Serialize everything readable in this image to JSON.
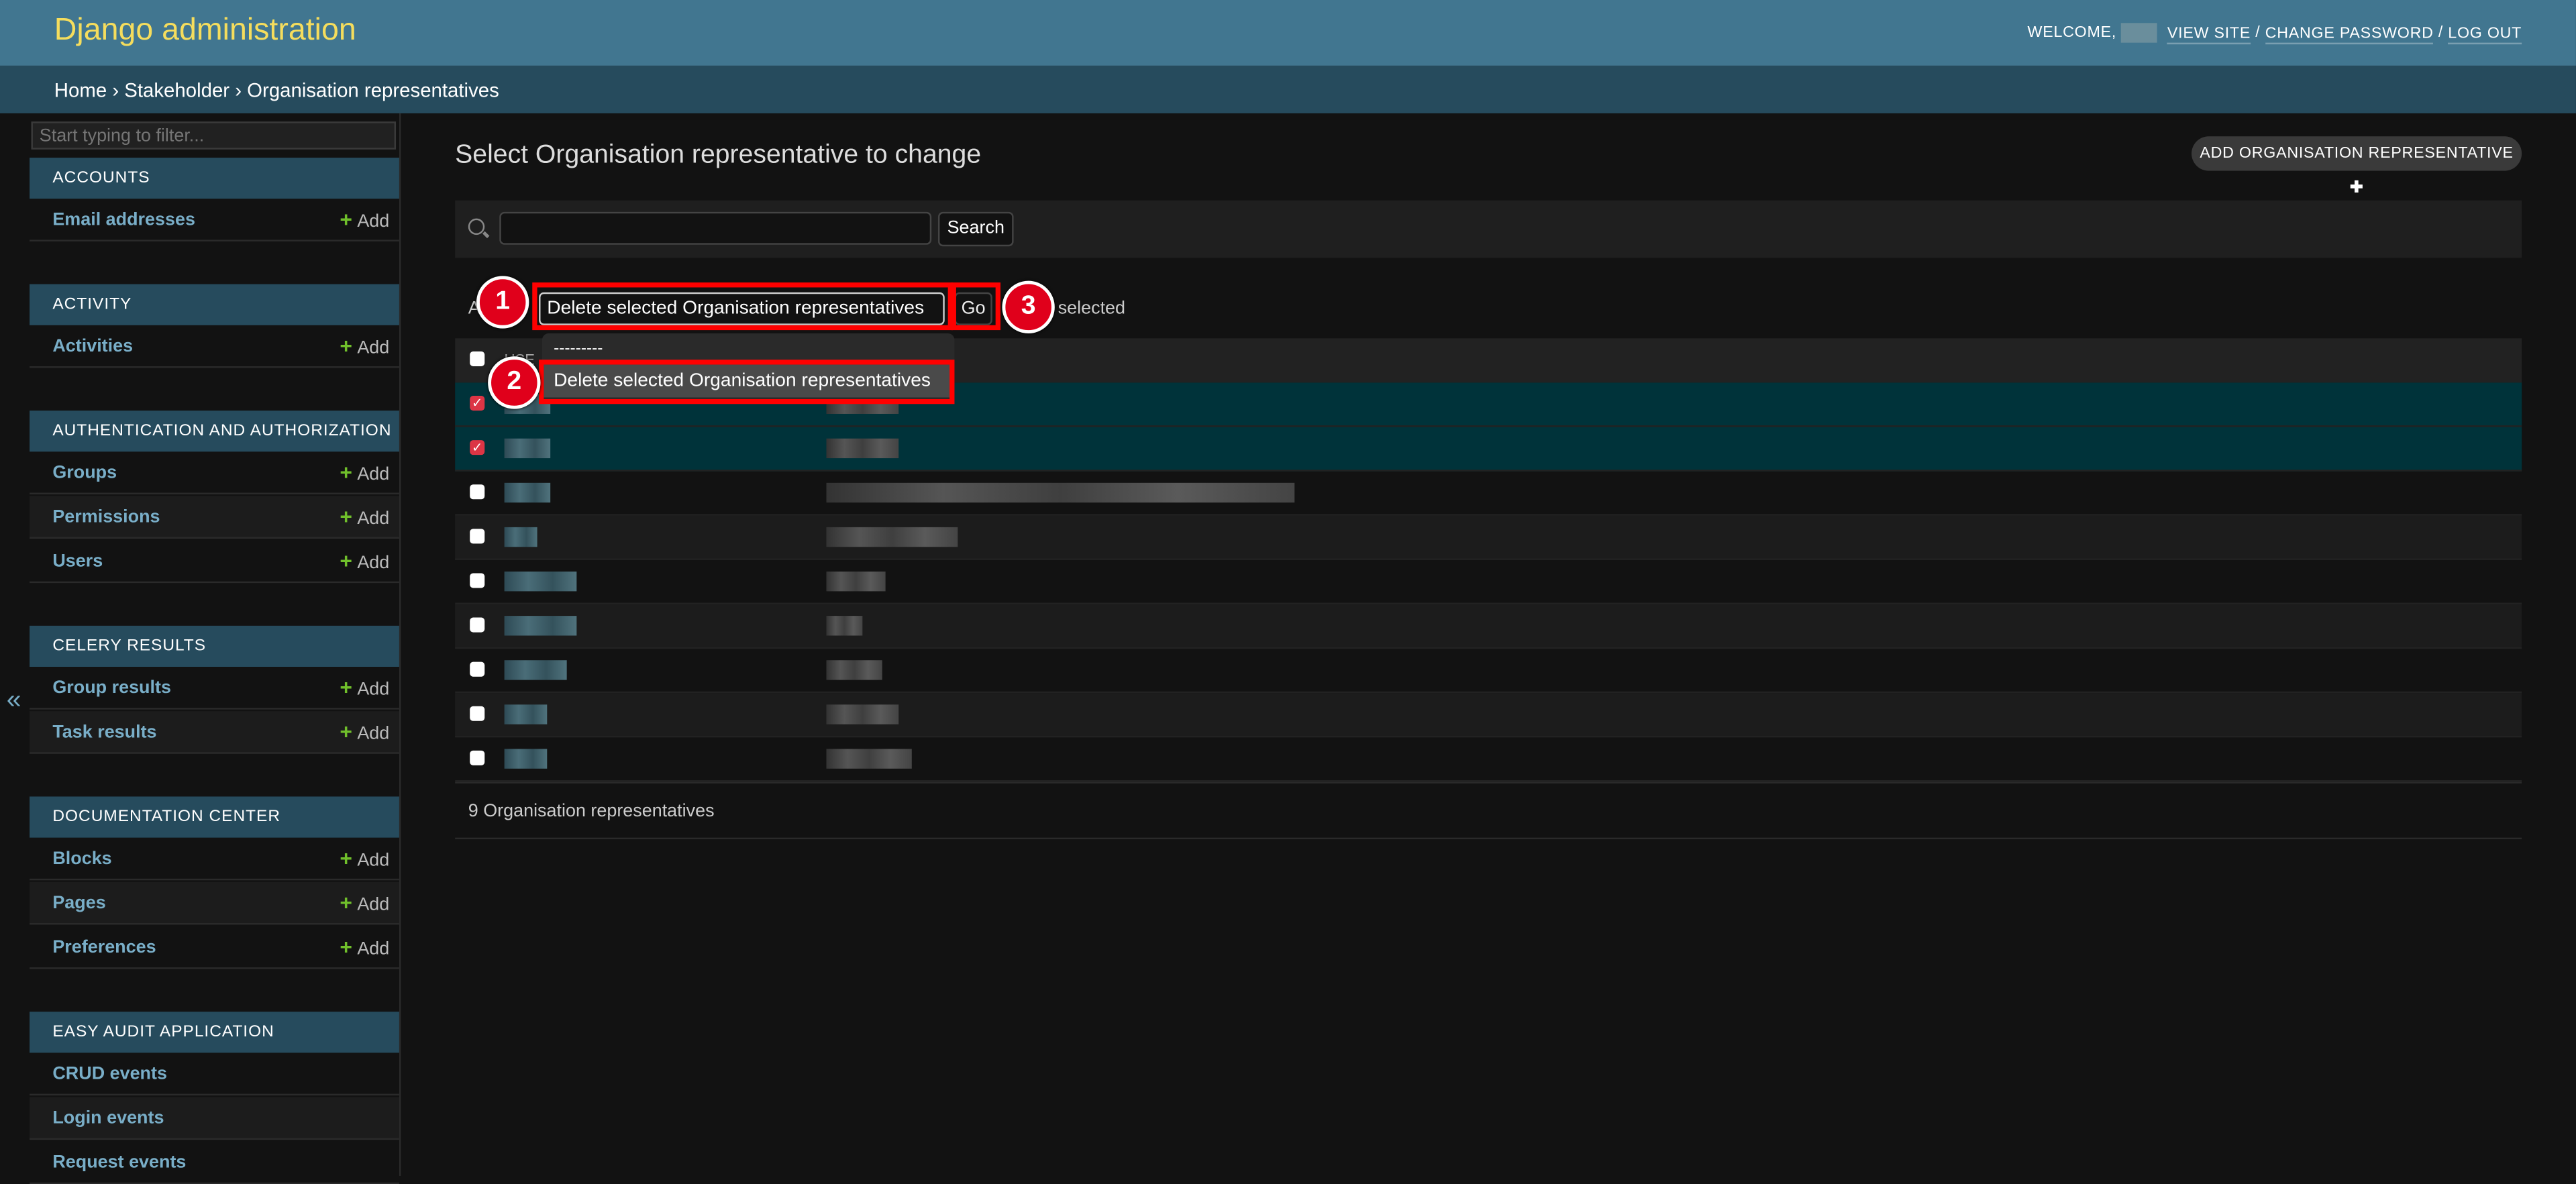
{
  "header": {
    "title": "Django administration",
    "welcome": "WELCOME,",
    "links": [
      "VIEW SITE",
      "CHANGE PASSWORD",
      "LOG OUT"
    ]
  },
  "breadcrumbs": "Home › Stakeholder › Organisation representatives",
  "sidebar": {
    "filter_placeholder": "Start typing to filter...",
    "collapse_label": "«",
    "add_label": "Add",
    "sections": [
      {
        "title": "ACCOUNTS",
        "items": [
          "Email addresses"
        ]
      },
      {
        "title": "ACTIVITY",
        "items": [
          "Activities"
        ]
      },
      {
        "title": "AUTHENTICATION AND AUTHORIZATION",
        "items": [
          "Groups",
          "Permissions",
          "Users"
        ]
      },
      {
        "title": "CELERY RESULTS",
        "items": [
          "Group results",
          "Task results"
        ]
      },
      {
        "title": "DOCUMENTATION CENTER",
        "items": [
          "Blocks",
          "Pages",
          "Preferences"
        ]
      },
      {
        "title": "EASY AUDIT APPLICATION",
        "items": [
          "CRUD events",
          "Login events",
          "Request events"
        ]
      }
    ]
  },
  "main": {
    "title": "Select Organisation representative to change",
    "add_button": "ADD ORGANISATION REPRESENTATIVE",
    "search_button": "Search",
    "action_label": "A",
    "action_selected": "Delete selected Organisation representatives",
    "go_button": "Go",
    "selected_text": "selected",
    "column_header": "USE",
    "dropdown_options": [
      "---------",
      "Delete selected Organisation representatives"
    ],
    "rows": [
      {
        "checked": true
      },
      {
        "checked": true
      },
      {
        "checked": false
      },
      {
        "checked": false
      },
      {
        "checked": false
      },
      {
        "checked": false
      },
      {
        "checked": false
      },
      {
        "checked": false
      },
      {
        "checked": false
      }
    ],
    "footer": "9 Organisation representatives"
  },
  "annotations": [
    "1",
    "2",
    "3"
  ],
  "colors": {
    "header": "#417690",
    "breadcrumb": "#264b5d",
    "brand": "#f5dd5d",
    "link": "#79aec8",
    "add": "#70bf2b",
    "selected_row": "#00333a",
    "annotation": "#ff0000"
  }
}
